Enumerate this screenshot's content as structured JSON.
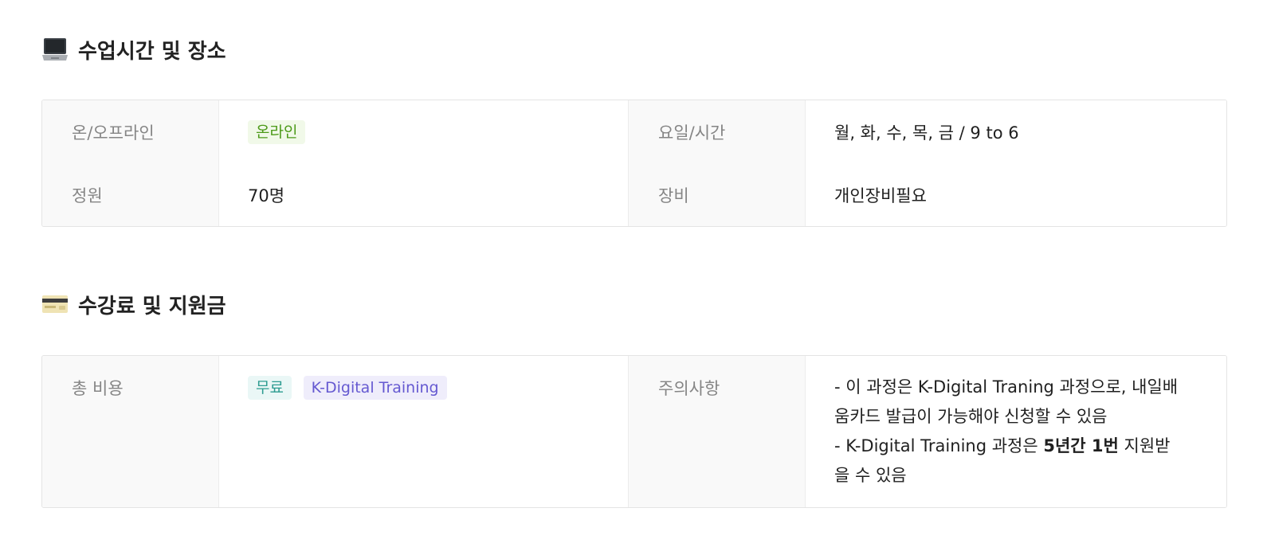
{
  "section1": {
    "icon": "laptop-icon",
    "title": "수업시간 및 장소",
    "rows": [
      {
        "label_left": "온/오프라인",
        "tag": "온라인",
        "label_right": "요일/시간",
        "value_right": "월, 화, 수, 목, 금 / 9 to 6"
      },
      {
        "label_left": "정원",
        "value_left": "70명",
        "label_right": "장비",
        "value_right": "개인장비필요"
      }
    ]
  },
  "section2": {
    "icon": "credit-card-icon",
    "title": "수강료 및 지원금",
    "cost_label": "총 비용",
    "tags": [
      "무료",
      "K-Digital Training"
    ],
    "notice_label": "주의사항",
    "notice": {
      "line1": "- 이 과정은 K-Digital Traning 과정으로, 내일배움카드 발급이 가능해야 신청할 수 있음",
      "line2_prefix": "- K-Digital Training 과정은 ",
      "line2_bold": "5년간 1번",
      "line2_suffix": " 지원받을 수 있음"
    }
  },
  "colors": {
    "tag_green_text": "#4c9a18",
    "tag_teal_text": "#2d9c91",
    "tag_purple_text": "#6559d1",
    "label_bg": "#f9f9f9"
  }
}
